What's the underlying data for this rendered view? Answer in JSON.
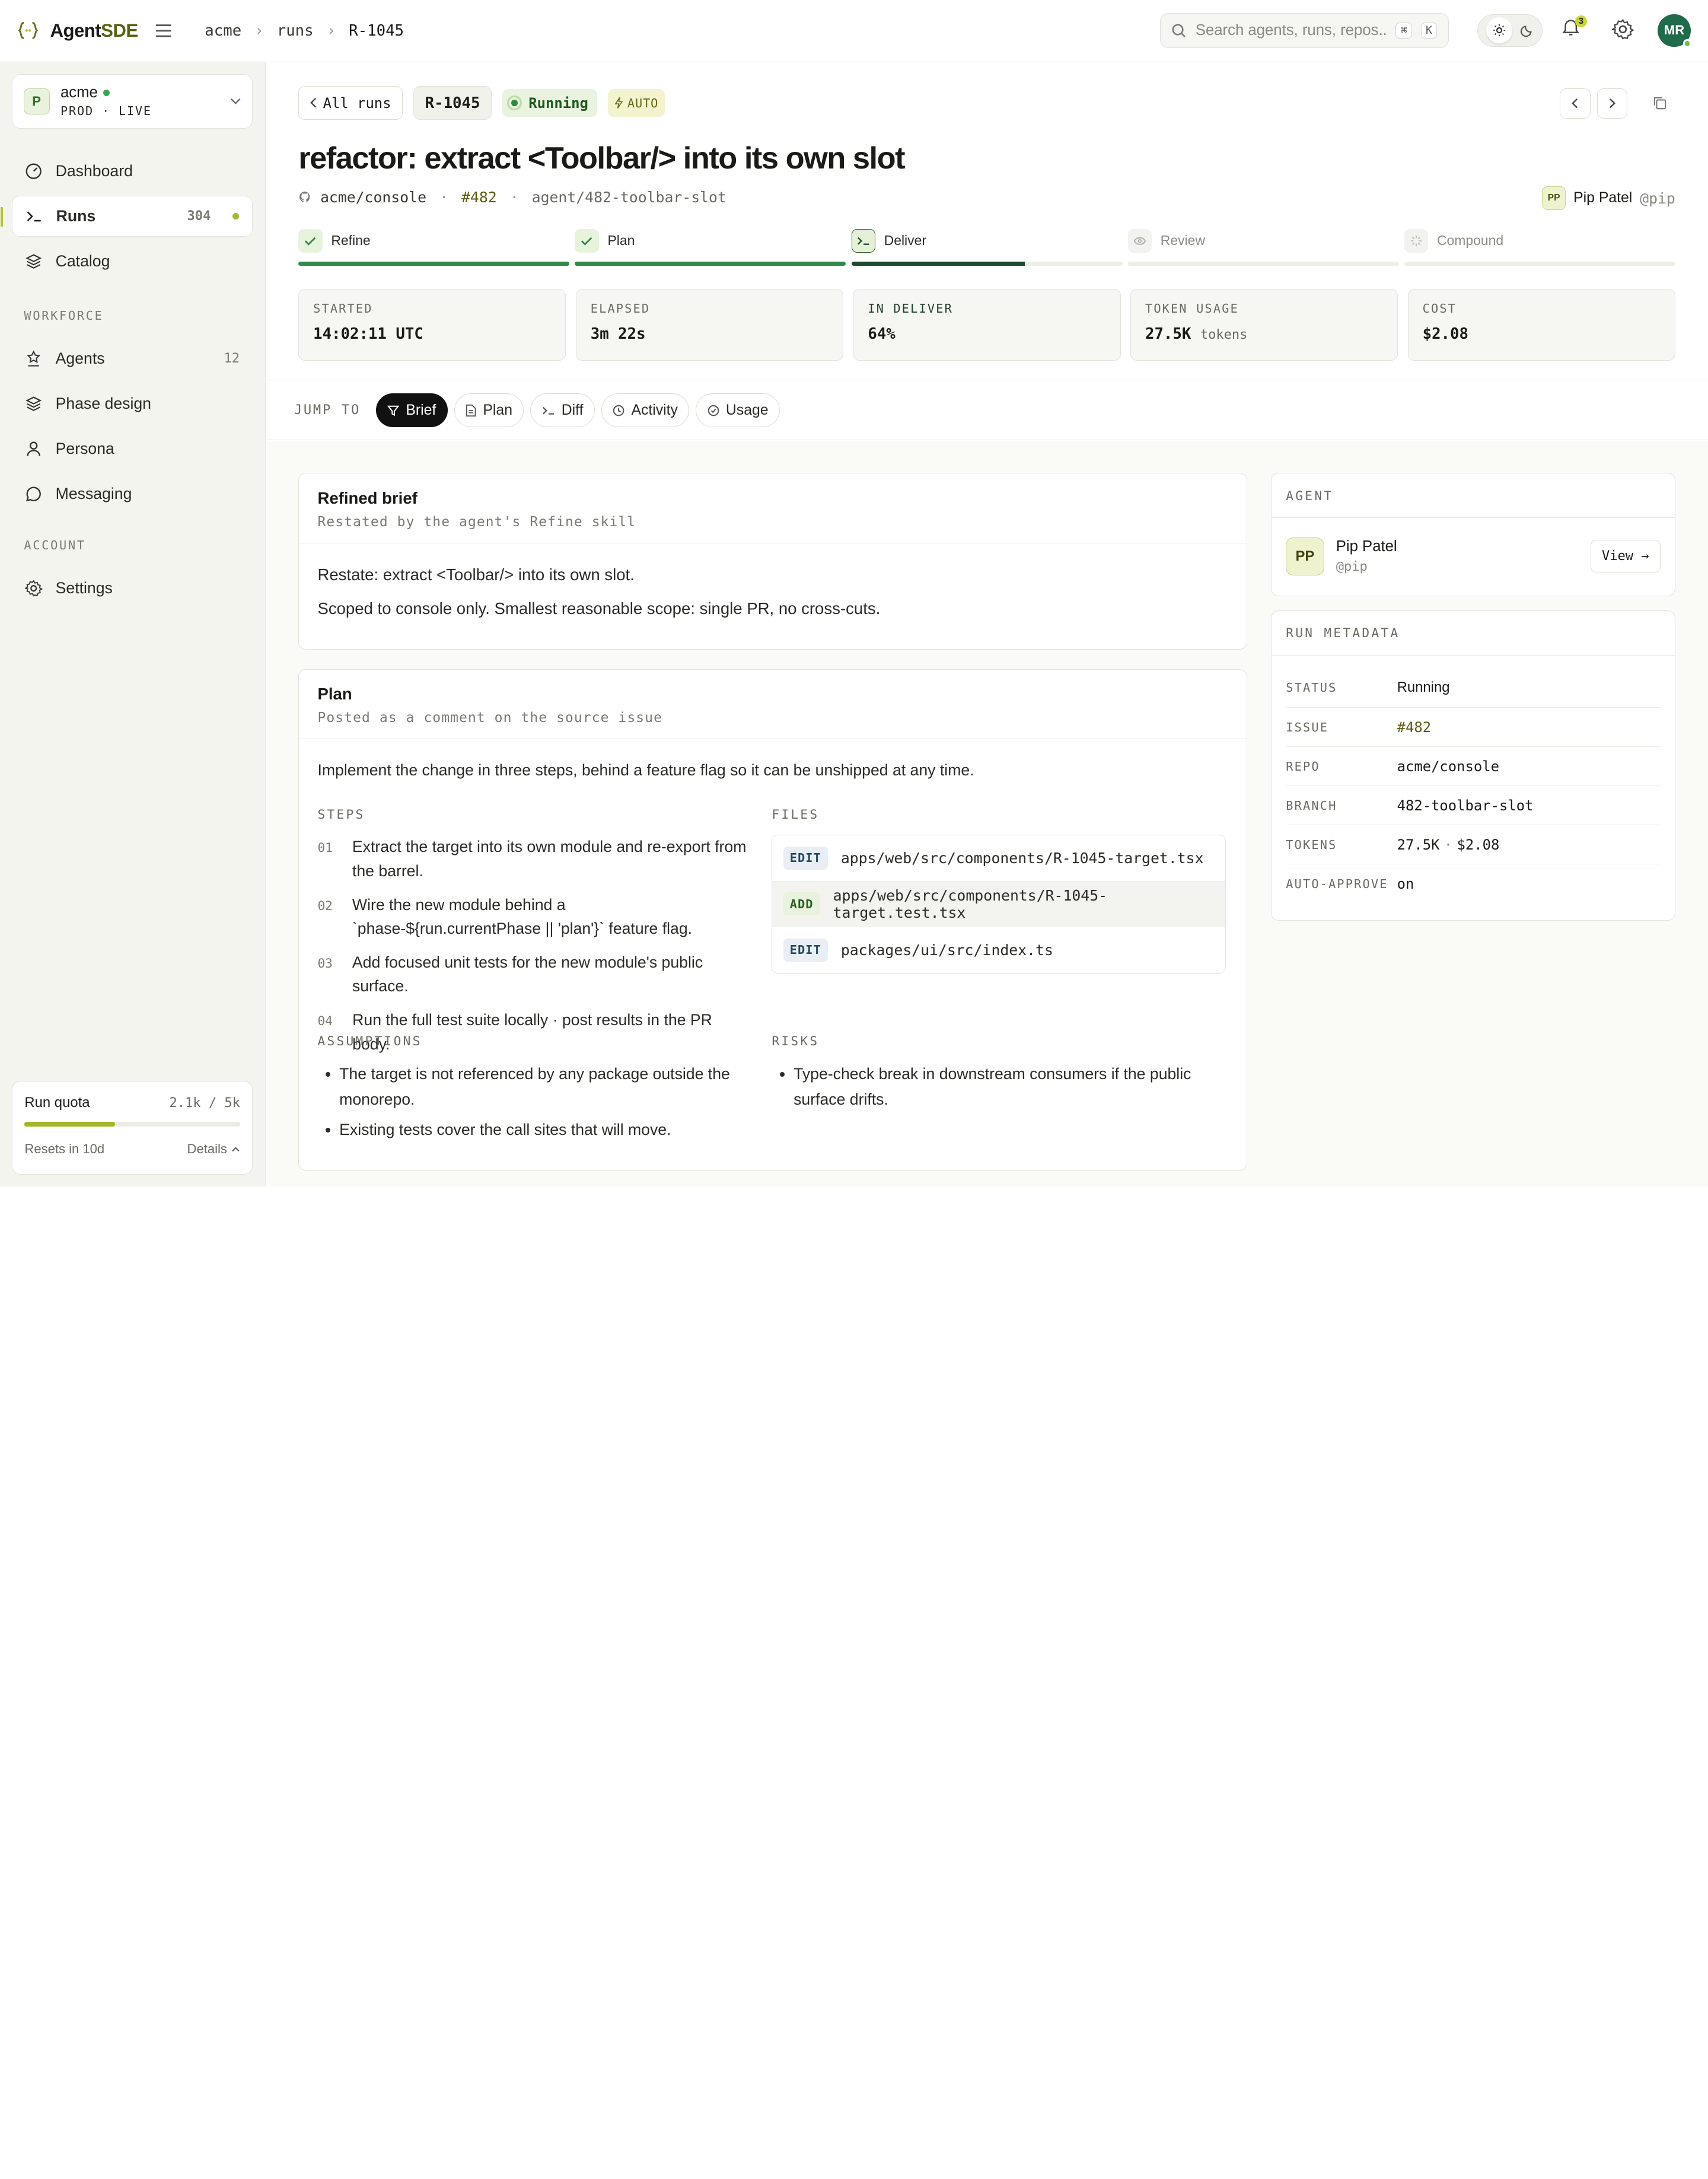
{
  "app": {
    "logo_prefix": "Agent",
    "logo_suffix": "SDE"
  },
  "breadcrumbs": [
    "acme",
    "runs",
    "R-1045"
  ],
  "search": {
    "placeholder": "Search agents, runs, repos...",
    "kbd_mod": "⌘",
    "kbd_key": "K"
  },
  "notifications": {
    "count": "3"
  },
  "user": {
    "initials": "MR"
  },
  "workspace": {
    "badge": "P",
    "name": "acme",
    "env": "PROD · LIVE"
  },
  "sidebar": {
    "primary": [
      {
        "label": "Dashboard",
        "icon": "dashboard-icon"
      },
      {
        "label": "Runs",
        "icon": "terminal-icon",
        "count": "304"
      },
      {
        "label": "Catalog",
        "icon": "layers-icon"
      }
    ],
    "workforce_title": "WORKFORCE",
    "workforce": [
      {
        "label": "Agents",
        "icon": "agents-icon",
        "count": "12"
      },
      {
        "label": "Phase design",
        "icon": "layers-icon"
      },
      {
        "label": "Persona",
        "icon": "person-icon"
      },
      {
        "label": "Messaging",
        "icon": "chat-icon"
      }
    ],
    "account_title": "ACCOUNT",
    "account": [
      {
        "label": "Settings",
        "icon": "gear-icon"
      }
    ],
    "quota": {
      "title": "Run quota",
      "value": "2.1k / 5k",
      "fraction": 0.42,
      "resets": "Resets in 10d",
      "details": "Details"
    }
  },
  "run": {
    "back_label": "All runs",
    "id": "R-1045",
    "status": "Running",
    "auto_label": "AUTO",
    "title": "refactor: extract <Toolbar/> into its own slot",
    "repo": "acme/console",
    "issue": "#482",
    "branch": "agent/482-toolbar-slot",
    "owner_initials": "PP",
    "owner_name": "Pip Patel",
    "owner_handle": "@pip"
  },
  "phases": [
    {
      "label": "Refine",
      "state": "done",
      "progress": 1.0
    },
    {
      "label": "Plan",
      "state": "done",
      "progress": 1.0
    },
    {
      "label": "Deliver",
      "state": "current",
      "progress": 0.64
    },
    {
      "label": "Review",
      "state": "pending",
      "progress": 0
    },
    {
      "label": "Compound",
      "state": "pending",
      "progress": 0
    }
  ],
  "stats": [
    {
      "label": "STARTED",
      "value": "14:02:11 UTC",
      "unit": ""
    },
    {
      "label": "ELAPSED",
      "value": "3m 22s",
      "unit": ""
    },
    {
      "label": "IN DELIVER",
      "value": "64%",
      "unit": ""
    },
    {
      "label": "TOKEN USAGE",
      "value": "27.5K",
      "unit": "tokens"
    },
    {
      "label": "COST",
      "value": "$2.08",
      "unit": ""
    }
  ],
  "jump": {
    "label": "JUMP TO",
    "chips": [
      "Brief",
      "Plan",
      "Diff",
      "Activity",
      "Usage"
    ]
  },
  "brief": {
    "title": "Refined brief",
    "subtitle": "Restated by the agent's Refine skill",
    "paragraphs": [
      "Restate: extract <Toolbar/> into its own slot.",
      "Scoped to console only. Smallest reasonable scope: single PR, no cross-cuts."
    ]
  },
  "plan": {
    "title": "Plan",
    "subtitle": "Posted as a comment on the source issue",
    "intro": "Implement the change in three steps, behind a feature flag so it can be unshipped at any time.",
    "steps_label": "STEPS",
    "steps": [
      {
        "num": "01",
        "text": "Extract the target into its own module and re-export from the barrel."
      },
      {
        "num": "02",
        "text": "Wire the new module behind a `phase-${run.currentPhase || 'plan'}` feature flag."
      },
      {
        "num": "03",
        "text": "Add focused unit tests for the new module's public surface."
      },
      {
        "num": "04",
        "text": "Run the full test suite locally · post results in the PR body."
      }
    ],
    "files_label": "FILES",
    "files": [
      {
        "op": "EDIT",
        "path": "apps/web/src/components/R-1045-target.tsx"
      },
      {
        "op": "ADD",
        "path": "apps/web/src/components/R-1045-target.test.tsx"
      },
      {
        "op": "EDIT",
        "path": "packages/ui/src/index.ts"
      }
    ],
    "assumptions_label": "ASSUMPTIONS",
    "assumptions": [
      "The target is not referenced by any package outside the monorepo.",
      "Existing tests cover the call sites that will move."
    ],
    "risks_label": "RISKS",
    "risks": [
      "Type-check break in downstream consumers if the public surface drifts."
    ]
  },
  "agent_card": {
    "title": "AGENT",
    "initials": "PP",
    "name": "Pip Patel",
    "handle": "@pip",
    "view_label": "View →"
  },
  "metadata": {
    "title": "RUN METADATA",
    "rows": [
      {
        "key": "STATUS",
        "value": "Running"
      },
      {
        "key": "ISSUE",
        "value": "#482"
      },
      {
        "key": "REPO",
        "value": "acme/console"
      },
      {
        "key": "BRANCH",
        "value": "482-toolbar-slot"
      },
      {
        "key": "TOKENS",
        "value": "27.5K",
        "extra": "$2.08"
      },
      {
        "key": "AUTO-APPROVE",
        "value": "on"
      }
    ]
  }
}
